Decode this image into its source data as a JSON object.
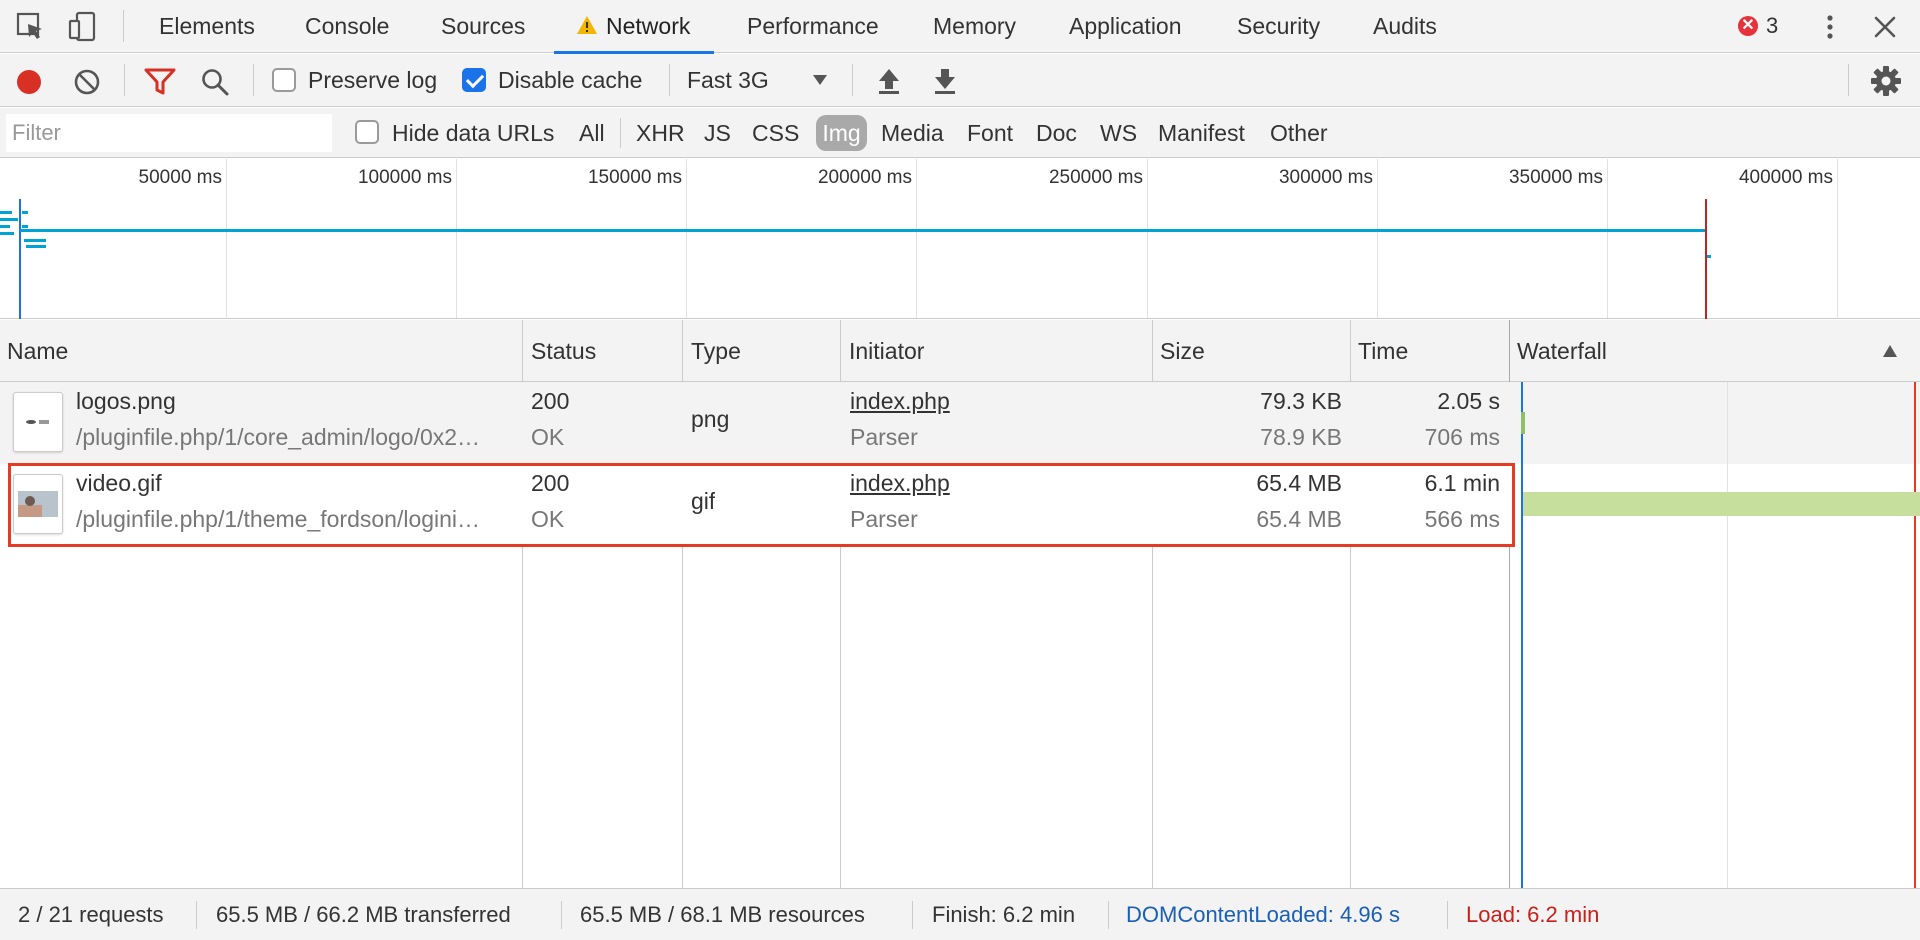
{
  "tabs": [
    "Elements",
    "Console",
    "Sources",
    "Network",
    "Performance",
    "Memory",
    "Application",
    "Security",
    "Audits"
  ],
  "active_tab": "Network",
  "error_count": "3",
  "toolbar": {
    "preserve_log": "Preserve log",
    "preserve_log_checked": false,
    "disable_cache": "Disable cache",
    "disable_cache_checked": true,
    "throttling": "Fast 3G"
  },
  "filter": {
    "placeholder": "Filter",
    "hide_data_urls": "Hide data URLs",
    "types": [
      "All",
      "XHR",
      "JS",
      "CSS",
      "Img",
      "Media",
      "Font",
      "Doc",
      "WS",
      "Manifest",
      "Other"
    ],
    "selected_type": "Img"
  },
  "overview": {
    "ticks": [
      "50000 ms",
      "100000 ms",
      "150000 ms",
      "200000 ms",
      "250000 ms",
      "300000 ms",
      "350000 ms",
      "400000 ms"
    ]
  },
  "columns": [
    "Name",
    "Status",
    "Type",
    "Initiator",
    "Size",
    "Time",
    "Waterfall"
  ],
  "rows": [
    {
      "name": "logos.png",
      "path": "/pluginfile.php/1/core_admin/logo/0x2…",
      "status": "200",
      "status_text": "OK",
      "type": "png",
      "initiator": "index.php",
      "initiator_type": "Parser",
      "size": "79.3 KB",
      "resource_size": "78.9 KB",
      "time": "2.05 s",
      "latency": "706 ms"
    },
    {
      "name": "video.gif",
      "path": "/pluginfile.php/1/theme_fordson/logini…",
      "status": "200",
      "status_text": "OK",
      "type": "gif",
      "initiator": "index.php",
      "initiator_type": "Parser",
      "size": "65.4 MB",
      "resource_size": "65.4 MB",
      "time": "6.1 min",
      "latency": "566 ms"
    }
  ],
  "status": {
    "requests": "2 / 21 requests",
    "transferred": "65.5 MB / 66.2 MB transferred",
    "resources": "65.5 MB / 68.1 MB resources",
    "finish": "Finish: 6.2 min",
    "dom_content_loaded": "DOMContentLoaded: 4.96 s",
    "load": "Load: 6.2 min"
  },
  "colors": {
    "accent": "#1a73e8",
    "record_red": "#d93025",
    "dcl_blue": "#1a5fb4",
    "load_red": "#c5221f",
    "highlight": "#e53a23",
    "waterfall_bar": "#c6df9c"
  }
}
